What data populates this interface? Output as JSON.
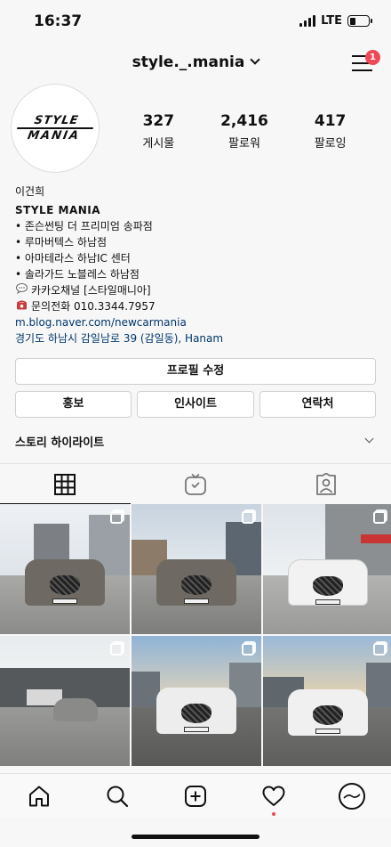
{
  "status_bar": {
    "time": "16:37",
    "network": "LTE",
    "battery_level": 0.3
  },
  "header": {
    "username": "style._.mania",
    "notification_count": "1"
  },
  "avatar": {
    "logo_line1": "STYLE",
    "logo_line2": "MANIA"
  },
  "stats": [
    {
      "value": "327",
      "label": "게시물"
    },
    {
      "value": "2,416",
      "label": "팔로워"
    },
    {
      "value": "417",
      "label": "팔로잉"
    }
  ],
  "bio": {
    "name": "이건희",
    "category": "STYLE MANIA",
    "lines": [
      "• 존슨썬팅 더 프리미엄 송파점",
      "• 루마버텍스 하남점",
      "• 아마테라스 하남IC 센터",
      "• 솔라가드 노블레스 하남점"
    ],
    "kakao": "카카오채널 [스타일매니아]",
    "phone": "문의전화 010.3344.7957",
    "link": "m.blog.naver.com/newcarmania",
    "address": "경기도 하남시 감일남로 39 (감일동), Hanam"
  },
  "buttons": {
    "edit_profile": "프로필 수정",
    "promote": "홍보",
    "insights": "인사이트",
    "contact": "연락처"
  },
  "highlights": {
    "label": "스토리 하이라이트"
  },
  "tabs": [
    {
      "icon": "grid-icon",
      "active": true
    },
    {
      "icon": "igtv-icon",
      "active": false
    },
    {
      "icon": "tagged-icon",
      "active": false
    }
  ],
  "posts": [
    {
      "icon": "multi-photo-icon",
      "car_color": "#6e6a63"
    },
    {
      "icon": "multi-photo-icon",
      "car_color": "#6e6a63"
    },
    {
      "icon": "multi-photo-icon",
      "car_color": "#f2f2f2"
    },
    {
      "icon": "multi-photo-icon",
      "car_color": "#8a8a88"
    },
    {
      "icon": "multi-photo-icon",
      "car_color": "#ededed"
    },
    {
      "icon": "multi-photo-icon",
      "car_color": "#f0f0f0"
    }
  ],
  "bottom_nav": [
    {
      "icon": "home-icon"
    },
    {
      "icon": "search-icon"
    },
    {
      "icon": "new-post-icon"
    },
    {
      "icon": "activity-heart-icon"
    },
    {
      "icon": "profile-avatar-icon"
    }
  ],
  "colors": {
    "badge": "#ed4956",
    "link": "#00376b"
  }
}
